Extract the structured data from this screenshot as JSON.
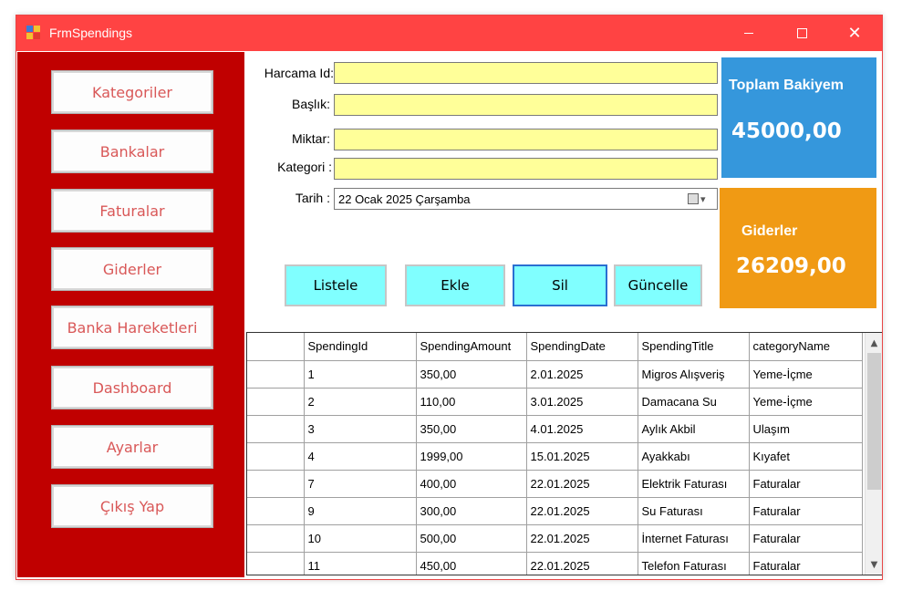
{
  "window": {
    "title": "FrmSpendings",
    "minimize_icon": "minimize-icon",
    "maximize_icon": "maximize-icon",
    "close_glyph": "✕"
  },
  "sidebar": {
    "background": "#c00000",
    "items": [
      {
        "label": "Kategoriler"
      },
      {
        "label": "Bankalar"
      },
      {
        "label": "Faturalar"
      },
      {
        "label": "Giderler"
      },
      {
        "label": "Banka Hareketleri"
      },
      {
        "label": "Dashboard"
      },
      {
        "label": "Ayarlar"
      },
      {
        "label": "Çıkış Yap"
      }
    ]
  },
  "form": {
    "id_label": "Harcama Id:",
    "title_label": "Başlık:",
    "amount_label": "Miktar:",
    "category_label": "Kategori :",
    "date_label": "Tarih :",
    "id_value": "",
    "title_value": "",
    "amount_value": "",
    "category_value": "",
    "date_value": "22  Ocak   2025 Çarşamba",
    "field_color": "#ffff99"
  },
  "actions": {
    "list_label": "Listele",
    "add_label": "Ekle",
    "delete_label": "Sil",
    "update_label": "Güncelle",
    "button_color": "#80ffff"
  },
  "stats": {
    "balance_title": "Toplam Bakiyem",
    "balance_value": "45000,00",
    "balance_color": "#3597dc",
    "expense_title": "Giderler",
    "expense_value": "26209,00",
    "expense_color": "#f09a14"
  },
  "grid": {
    "columns": [
      "SpendingId",
      "SpendingAmount",
      "SpendingDate",
      "SpendingTitle",
      "categoryName"
    ],
    "rows": [
      [
        "1",
        "350,00",
        "2.01.2025",
        "Migros Alışveriş",
        "Yeme-İçme"
      ],
      [
        "2",
        "110,00",
        "3.01.2025",
        "Damacana Su",
        "Yeme-İçme"
      ],
      [
        "3",
        "350,00",
        "4.01.2025",
        "Aylık Akbil",
        "Ulaşım"
      ],
      [
        "4",
        "1999,00",
        "15.01.2025",
        "Ayakkabı",
        "Kıyafet"
      ],
      [
        "7",
        "400,00",
        "22.01.2025",
        "Elektrik Faturası",
        "Faturalar"
      ],
      [
        "9",
        "300,00",
        "22.01.2025",
        "Su Faturası",
        "Faturalar"
      ],
      [
        "10",
        "500,00",
        "22.01.2025",
        "İnternet Faturası",
        "Faturalar"
      ],
      [
        "11",
        "450,00",
        "22.01.2025",
        "Telefon Faturası",
        "Faturalar"
      ]
    ]
  }
}
